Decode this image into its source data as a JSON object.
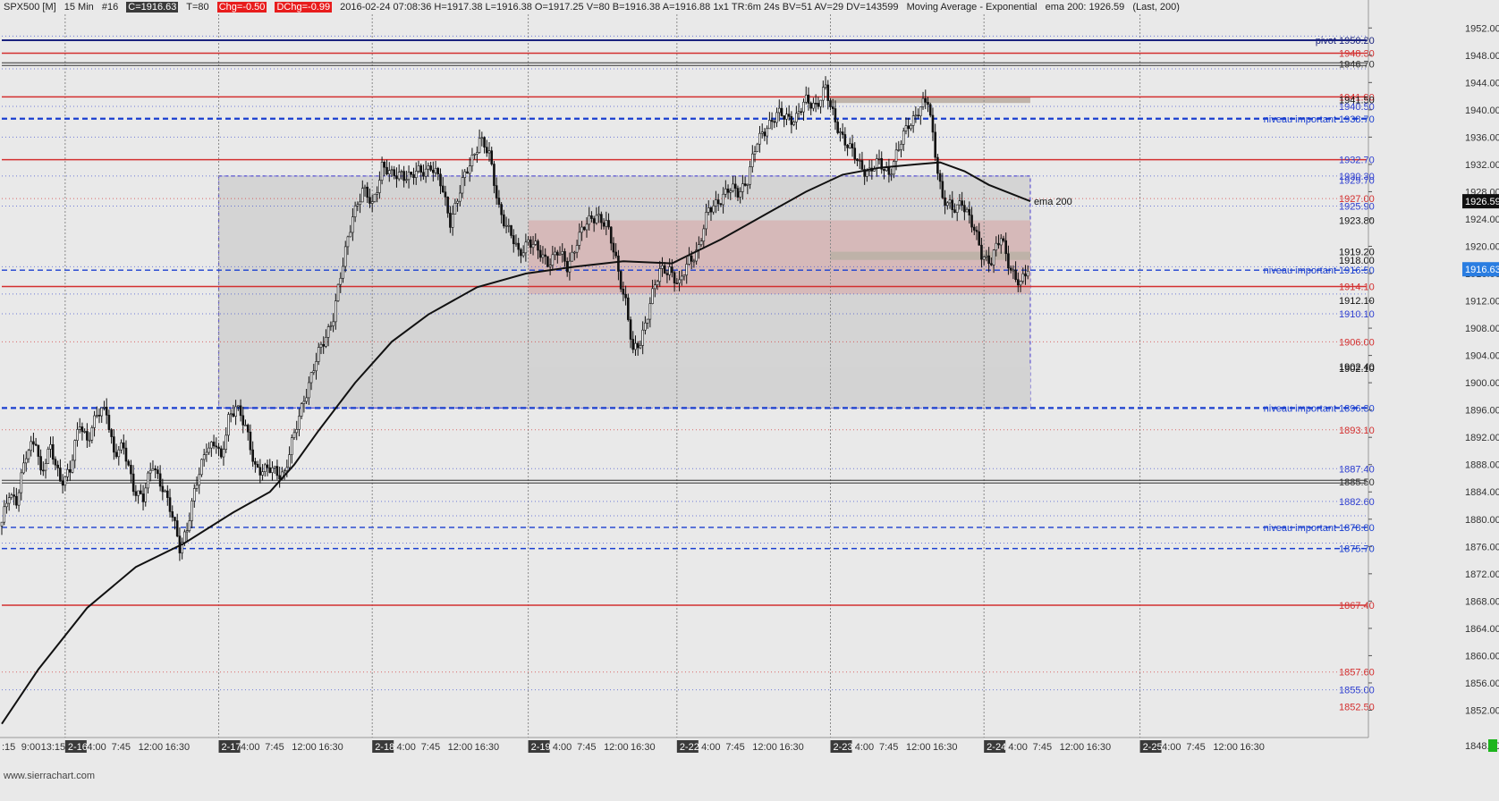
{
  "header": {
    "symbol": "SPX500 [M]",
    "timeframe": "15 Min",
    "bars": "#16",
    "close": "C=1916.63",
    "trades": "T=80",
    "chg": "Chg=-0.50",
    "dchg": "DChg=-0.99",
    "info": "2016-02-24 07:08:36 H=1917.38 L=1916.38 O=1917.25 V=80 B=1916.38 A=1916.88 1x1 TR:6m 24s BV=51 AV=29 DV=143599",
    "study": "Moving Average - Exponential",
    "study_value": "ema 200: 1926.59",
    "study_params": "(Last, 200)"
  },
  "watermark": "www.sierrachart.com",
  "chart_data": {
    "type": "candlestick",
    "ylim": [
      1848,
      1954
    ],
    "y_ticks": [
      1852,
      1856,
      1860,
      1864,
      1868,
      1872,
      1876,
      1880,
      1884,
      1888,
      1892,
      1896,
      1900,
      1904,
      1908,
      1912,
      1916,
      1920,
      1924,
      1928,
      1932,
      1936,
      1940,
      1944,
      1948,
      1952
    ],
    "y_tick_labels": [
      "1852.00",
      "1856.00",
      "1860.00",
      "1864.00",
      "1868.00",
      "1872.00",
      "1876.00",
      "1880.00",
      "1884.00",
      "1888.00",
      "1892.00",
      "1896.00",
      "1900.00",
      "1904.00",
      "1908.00",
      "1912.00",
      "1916.00",
      "1920.00",
      "1924.00",
      "1928.00",
      "1932.00",
      "1936.00",
      "1940.00",
      "1944.00",
      "1948.00",
      "1952.00"
    ],
    "time_index_range": [
      0,
      560
    ],
    "x_ticks": [
      {
        "i": 0,
        "label": ":15"
      },
      {
        "i": 8,
        "label": "9:00"
      },
      {
        "i": 16,
        "label": "13:15"
      },
      {
        "i": 26,
        "label": "2-16",
        "day": true
      },
      {
        "i": 35,
        "label": "4:00"
      },
      {
        "i": 45,
        "label": "7:45"
      },
      {
        "i": 56,
        "label": "12:00"
      },
      {
        "i": 67,
        "label": "16:30"
      },
      {
        "i": 89,
        "label": "2-17",
        "day": true
      },
      {
        "i": 98,
        "label": "4:00"
      },
      {
        "i": 108,
        "label": "7:45"
      },
      {
        "i": 119,
        "label": "12:00"
      },
      {
        "i": 130,
        "label": "16:30"
      },
      {
        "i": 152,
        "label": "2-18",
        "day": true
      },
      {
        "i": 162,
        "label": "4:00"
      },
      {
        "i": 172,
        "label": "7:45"
      },
      {
        "i": 183,
        "label": "12:00"
      },
      {
        "i": 194,
        "label": "16:30"
      },
      {
        "i": 216,
        "label": "2-19",
        "day": true
      },
      {
        "i": 226,
        "label": "4:00"
      },
      {
        "i": 236,
        "label": "7:45"
      },
      {
        "i": 247,
        "label": "12:00"
      },
      {
        "i": 258,
        "label": "16:30"
      },
      {
        "i": 277,
        "label": "2-22",
        "day": true
      },
      {
        "i": 287,
        "label": "4:00"
      },
      {
        "i": 297,
        "label": "7:45"
      },
      {
        "i": 308,
        "label": "12:00"
      },
      {
        "i": 319,
        "label": "16:30"
      },
      {
        "i": 340,
        "label": "2-23",
        "day": true
      },
      {
        "i": 350,
        "label": "4:00"
      },
      {
        "i": 360,
        "label": "7:45"
      },
      {
        "i": 371,
        "label": "12:00"
      },
      {
        "i": 382,
        "label": "16:30"
      },
      {
        "i": 403,
        "label": "2-24",
        "day": true
      },
      {
        "i": 413,
        "label": "4:00"
      },
      {
        "i": 423,
        "label": "7:45"
      },
      {
        "i": 434,
        "label": "12:00"
      },
      {
        "i": 445,
        "label": "16:30"
      },
      {
        "i": 467,
        "label": "2-25",
        "day": true
      },
      {
        "i": 476,
        "label": "4:00"
      },
      {
        "i": 486,
        "label": "7:45"
      },
      {
        "i": 497,
        "label": "12:00"
      },
      {
        "i": 508,
        "label": "16:30"
      }
    ],
    "day_separators": [
      26,
      89,
      152,
      216,
      277,
      340,
      403,
      467
    ],
    "price_path": [
      [
        0,
        1879
      ],
      [
        3,
        1884
      ],
      [
        6,
        1883
      ],
      [
        10,
        1889
      ],
      [
        14,
        1892
      ],
      [
        16,
        1887
      ],
      [
        20,
        1890
      ],
      [
        24,
        1886
      ],
      [
        28,
        1887
      ],
      [
        32,
        1894
      ],
      [
        35,
        1892
      ],
      [
        39,
        1895
      ],
      [
        43,
        1896
      ],
      [
        46,
        1890
      ],
      [
        50,
        1890
      ],
      [
        54,
        1885
      ],
      [
        58,
        1883
      ],
      [
        62,
        1888
      ],
      [
        66,
        1885
      ],
      [
        70,
        1880
      ],
      [
        73,
        1876
      ],
      [
        76,
        1879
      ],
      [
        80,
        1885
      ],
      [
        84,
        1891
      ],
      [
        88,
        1891
      ],
      [
        90,
        1888
      ],
      [
        93,
        1895
      ],
      [
        96,
        1897
      ],
      [
        100,
        1893
      ],
      [
        104,
        1888
      ],
      [
        108,
        1887
      ],
      [
        112,
        1887
      ],
      [
        116,
        1887
      ],
      [
        120,
        1892
      ],
      [
        124,
        1898
      ],
      [
        128,
        1902
      ],
      [
        132,
        1906
      ],
      [
        136,
        1910
      ],
      [
        140,
        1917
      ],
      [
        144,
        1925
      ],
      [
        148,
        1928
      ],
      [
        152,
        1926
      ],
      [
        156,
        1932
      ],
      [
        160,
        1930
      ],
      [
        164,
        1931
      ],
      [
        168,
        1930
      ],
      [
        172,
        1931
      ],
      [
        176,
        1932
      ],
      [
        180,
        1929
      ],
      [
        184,
        1924
      ],
      [
        188,
        1928
      ],
      [
        192,
        1932
      ],
      [
        196,
        1936
      ],
      [
        200,
        1933
      ],
      [
        204,
        1926
      ],
      [
        208,
        1922
      ],
      [
        212,
        1919
      ],
      [
        216,
        1921
      ],
      [
        220,
        1919
      ],
      [
        224,
        1918
      ],
      [
        228,
        1919
      ],
      [
        232,
        1917
      ],
      [
        236,
        1921
      ],
      [
        240,
        1923
      ],
      [
        244,
        1925
      ],
      [
        248,
        1923
      ],
      [
        252,
        1918
      ],
      [
        256,
        1912
      ],
      [
        259,
        1904
      ],
      [
        262,
        1906
      ],
      [
        266,
        1912
      ],
      [
        270,
        1916
      ],
      [
        274,
        1917
      ],
      [
        278,
        1914
      ],
      [
        282,
        1918
      ],
      [
        286,
        1920
      ],
      [
        290,
        1925
      ],
      [
        294,
        1927
      ],
      [
        298,
        1928
      ],
      [
        302,
        1928
      ],
      [
        306,
        1930
      ],
      [
        310,
        1935
      ],
      [
        314,
        1938
      ],
      [
        318,
        1939
      ],
      [
        322,
        1939
      ],
      [
        326,
        1939
      ],
      [
        330,
        1941
      ],
      [
        334,
        1941
      ],
      [
        338,
        1943
      ],
      [
        340,
        1940
      ],
      [
        344,
        1937
      ],
      [
        348,
        1934
      ],
      [
        352,
        1932
      ],
      [
        356,
        1931
      ],
      [
        360,
        1932
      ],
      [
        364,
        1931
      ],
      [
        368,
        1934
      ],
      [
        372,
        1938
      ],
      [
        376,
        1940
      ],
      [
        380,
        1941
      ],
      [
        383,
        1934
      ],
      [
        386,
        1927
      ],
      [
        390,
        1925
      ],
      [
        394,
        1927
      ],
      [
        398,
        1923
      ],
      [
        402,
        1919
      ],
      [
        406,
        1918
      ],
      [
        410,
        1921
      ],
      [
        414,
        1917
      ],
      [
        418,
        1914
      ],
      [
        421,
        1916.63
      ]
    ],
    "ema": {
      "name": "ema 200",
      "value_label": "1926.59",
      "path": [
        [
          0,
          1850
        ],
        [
          15,
          1858
        ],
        [
          35,
          1867
        ],
        [
          55,
          1873
        ],
        [
          75,
          1876.5
        ],
        [
          95,
          1881
        ],
        [
          110,
          1884
        ],
        [
          120,
          1888
        ],
        [
          130,
          1893
        ],
        [
          145,
          1900
        ],
        [
          160,
          1906
        ],
        [
          175,
          1910
        ],
        [
          195,
          1914
        ],
        [
          215,
          1916
        ],
        [
          235,
          1917
        ],
        [
          255,
          1917.8
        ],
        [
          275,
          1917.5
        ],
        [
          295,
          1921
        ],
        [
          315,
          1925
        ],
        [
          330,
          1928
        ],
        [
          345,
          1930.5
        ],
        [
          360,
          1931.5
        ],
        [
          375,
          1932
        ],
        [
          385,
          1932.3
        ],
        [
          395,
          1931
        ],
        [
          405,
          1929
        ],
        [
          422,
          1926.6
        ]
      ]
    },
    "horizontal_levels": [
      {
        "price": 1950.2,
        "style": "solid",
        "color": "#1a237e",
        "width": 2,
        "label": "1950.20",
        "tag": "pivot"
      },
      {
        "price": 1948.3,
        "style": "solid",
        "color": "#d32f2f",
        "width": 1.5,
        "label": "1948.30"
      },
      {
        "price": 1946.7,
        "style": "double",
        "color": "#333333",
        "width": 1,
        "label": "1946.70"
      },
      {
        "price": 1941.9,
        "style": "solid",
        "color": "#d32f2f",
        "width": 1.5,
        "label": "1941.90"
      },
      {
        "price": 1941.5,
        "style": "none",
        "color": "#111111",
        "width": 1,
        "label": "1941.50"
      },
      {
        "price": 1940.5,
        "style": "none",
        "color": "#2f3fd0",
        "width": 1,
        "label": "1940.50"
      },
      {
        "price": 1938.7,
        "style": "dashed",
        "color": "#1a3fd0",
        "width": 2.2,
        "label": "1938.70",
        "tag": "niveau important"
      },
      {
        "price": 1932.7,
        "style": "solid",
        "color": "#d32f2f",
        "width": 1.5,
        "label": "1932.70",
        "label_color": "#2f3fd0"
      },
      {
        "price": 1930.3,
        "style": "none",
        "color": "#2f3fd0",
        "width": 1,
        "label": "1930.30"
      },
      {
        "price": 1929.7,
        "style": "none",
        "color": "#2f3fd0",
        "width": 1,
        "label": "1929.70"
      },
      {
        "price": 1927.0,
        "style": "none",
        "color": "#d32f2f",
        "width": 1,
        "label": "1927.00"
      },
      {
        "price": 1925.9,
        "style": "none",
        "color": "#2f3fd0",
        "width": 1,
        "label": "1925.90"
      },
      {
        "price": 1923.8,
        "style": "none",
        "color": "#111111",
        "width": 1,
        "label": "1923.80"
      },
      {
        "price": 1919.2,
        "style": "none",
        "color": "#111111",
        "width": 1,
        "label": "1919.20"
      },
      {
        "price": 1918.0,
        "style": "none",
        "color": "#111111",
        "width": 1,
        "label": "1918.00"
      },
      {
        "price": 1916.5,
        "style": "dashed",
        "color": "#1a3fd0",
        "width": 1.3,
        "label": "1916.50",
        "tag": "niveau important"
      },
      {
        "price": 1914.1,
        "style": "solid",
        "color": "#d32f2f",
        "width": 1.5,
        "label": "1914.10"
      },
      {
        "price": 1912.1,
        "style": "none",
        "color": "#111111",
        "width": 1,
        "label": "1912.10"
      },
      {
        "price": 1910.1,
        "style": "none",
        "color": "#2f3fd0",
        "width": 1,
        "label": "1910.10"
      },
      {
        "price": 1906.0,
        "style": "none",
        "color": "#d32f2f",
        "width": 1,
        "label": "1906.00"
      },
      {
        "price": 1902.4,
        "style": "none",
        "color": "#111111",
        "width": 1,
        "label": "1902.40"
      },
      {
        "price": 1902.1,
        "style": "none",
        "color": "#111111",
        "width": 1,
        "label": "1902.10"
      },
      {
        "price": 1896.3,
        "style": "dashed",
        "color": "#1a3fd0",
        "width": 2.2,
        "label": "1896.30",
        "tag": "niveau important"
      },
      {
        "price": 1893.1,
        "style": "none",
        "color": "#d32f2f",
        "width": 1,
        "label": "1893.10"
      },
      {
        "price": 1887.4,
        "style": "none",
        "color": "#2f3fd0",
        "width": 1,
        "label": "1887.40"
      },
      {
        "price": 1885.5,
        "style": "double",
        "color": "#333333",
        "width": 1,
        "label": "1885.50"
      },
      {
        "price": 1882.6,
        "style": "none",
        "color": "#2f3fd0",
        "width": 1,
        "label": "1882.60"
      },
      {
        "price": 1878.8,
        "style": "dashed",
        "color": "#1a3fd0",
        "width": 1.3,
        "label": "1878.80",
        "tag": "niveau important"
      },
      {
        "price": 1875.7,
        "style": "dashed",
        "color": "#1a3fd0",
        "width": 1.5,
        "label": "1875.70"
      },
      {
        "price": 1867.4,
        "style": "solid",
        "color": "#d32f2f",
        "width": 1.5,
        "label": "1867.40"
      },
      {
        "price": 1857.6,
        "style": "none",
        "color": "#d32f2f",
        "width": 1,
        "label": "1857.60"
      },
      {
        "price": 1855.0,
        "style": "none",
        "color": "#2f3fd0",
        "width": 1,
        "label": "1855.00"
      },
      {
        "price": 1852.5,
        "style": "none",
        "color": "#d32f2f",
        "width": 1,
        "label": "1852.50"
      }
    ],
    "dotted_levels": [
      1950.8,
      1946.0,
      1940.5,
      1936.0,
      1930.3,
      1927.0,
      1925.9,
      1917.0,
      1913.0,
      1910.1,
      1906.0,
      1893.1,
      1887.4,
      1882.6,
      1880.5,
      1876.5,
      1857.6,
      1855.0
    ],
    "zones": [
      {
        "from": [
          89,
          1896.3
        ],
        "to": [
          422,
          1930.3
        ],
        "fill": "#d3d3d3",
        "border": "#5a4fd0"
      },
      {
        "from": [
          216,
          1913.0
        ],
        "to": [
          422,
          1923.8
        ],
        "fill": "#d6b7b7"
      },
      {
        "from": [
          216,
          1896.3
        ],
        "to": [
          422,
          1902.4
        ],
        "fill": "#d3d3d3"
      },
      {
        "from": [
          340,
          1918.0
        ],
        "to": [
          422,
          1919.2
        ],
        "fill": "#bdb1a6"
      },
      {
        "from": [
          340,
          1941.0
        ],
        "to": [
          422,
          1941.9
        ],
        "fill": "#bdb1a6"
      }
    ],
    "last_price_label": "1916.63",
    "ema_axis_label": "1926.59",
    "axis_bottom_label": "1848.00"
  }
}
